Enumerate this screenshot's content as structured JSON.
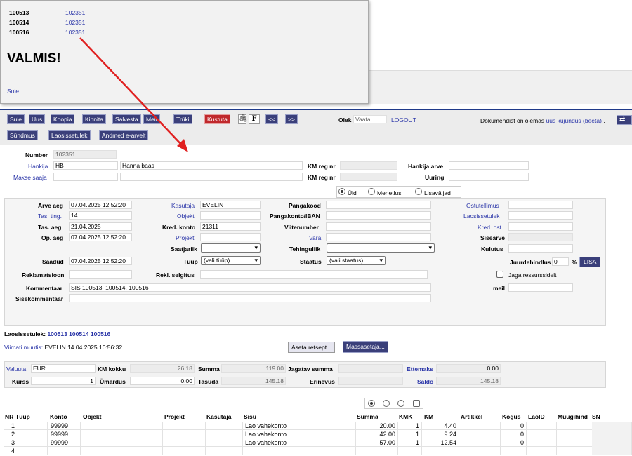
{
  "popup": {
    "rows": [
      {
        "id": "100513",
        "ref": "102351"
      },
      {
        "id": "100514",
        "ref": "102351"
      },
      {
        "id": "100516",
        "ref": "102351"
      }
    ],
    "done": "VALMIS!",
    "close": "Sule"
  },
  "toolbar": {
    "buttons": [
      "Sule",
      "Uus",
      "Koopia",
      "Kinnita",
      "Salvesta",
      "Meil",
      "Trüki",
      "Kustuta"
    ],
    "f_label": "F",
    "prev": "<<",
    "next": ">>",
    "olek_label": "Olek",
    "olek_value": "Vaata",
    "logout": "LOGOUT",
    "design_text": "Dokumendist on olemas",
    "design_link": "uus kujundus (beeta)",
    "design_dot": ".",
    "buttons2": [
      "Sündmus",
      "Laosissetulek",
      "Andmed e-arvelt"
    ]
  },
  "header": {
    "number_label": "Number",
    "number_value": "102351",
    "hankija_label": "Hankija",
    "hankija_code": "HB",
    "hankija_name": "Hanna baas",
    "km_reg_label": "KM reg nr",
    "hankija_arve_label": "Hankija arve",
    "makse_saaja_label": "Makse saaja",
    "km_reg_label2": "KM reg nr",
    "uuring_label": "Uuring"
  },
  "tabs": {
    "yld": "Üld",
    "menetlus": "Menetlus",
    "lisavaljad": "Lisaväljad"
  },
  "form": {
    "arve_aeg_label": "Arve aeg",
    "arve_aeg": "07.04.2025 12:52:20",
    "tas_ting_label": "Tas. ting.",
    "tas_ting": "14",
    "tas_aeg_label": "Tas. aeg",
    "tas_aeg": "21.04.2025",
    "op_aeg_label": "Op. aeg",
    "op_aeg": "07.04.2025 12:52:20",
    "saadud_label": "Saadud",
    "saadud": "07.04.2025 12:52:20",
    "reklamatsioon_label": "Reklamatsioon",
    "kommentaar_label": "Kommentaar",
    "kommentaar": "SIS 100513, 100514, 100516",
    "sisekommentaar_label": "Sisekommentaar",
    "kasutaja_label": "Kasutaja",
    "kasutaja": "EVELIN",
    "objekt_label": "Objekt",
    "kred_konto_label": "Kred. konto",
    "kred_konto": "21311",
    "projekt_label": "Projekt",
    "saatjariik_label": "Saatjariik",
    "tyyp_label": "Tüüp",
    "tyyp": "(vali tüüp)",
    "rekl_selgitus_label": "Rekl. selgitus",
    "pangakood_label": "Pangakood",
    "pangakonto_label": "Pangakonto/IBAN",
    "viitenumber_label": "Viitenumber",
    "vara_label": "Vara",
    "tehinguliik_label": "Tehinguliik",
    "staatus_label": "Staatus",
    "staatus": "(vali staatus)",
    "ostutellimus_label": "Ostutellimus",
    "laosissetulek_label": "Laosissetulek",
    "kred_ost_label": "Kred. ost",
    "sisearve_label": "Sisearve",
    "kulutus_label": "Kulutus",
    "juurdehindlus_label": "Juurdehindlus",
    "juurdehindlus": "0",
    "percent": "%",
    "lisa": "LISA",
    "jaga_label": "Jaga ressurssidelt",
    "meil_label": "meil"
  },
  "info": {
    "laosissetulek_label": "Laosissetulek:",
    "laosissetulek_links": "100513 100514 100516",
    "viimati_label": "Viimati muutis:",
    "viimati_value": "EVELIN 14.04.2025 10:56:32",
    "aseta_btn": "Aseta retsept...",
    "massasetaja_btn": "Massasetaja..."
  },
  "totals": {
    "valuuta_label": "Valuuta",
    "valuuta": "EUR",
    "km_kokku_label": "KM kokku",
    "km_kokku": "26.18",
    "summa_label": "Summa",
    "summa": "119.00",
    "jagatav_label": "Jagatav summa",
    "ettemaks_label": "Ettemaks",
    "ettemaks": "0.00",
    "kurss_label": "Kurss",
    "kurss": "1",
    "umardus_label": "Ümardus",
    "umardus": "0.00",
    "tasuda_label": "Tasuda",
    "tasuda": "145.18",
    "erinevus_label": "Erinevus",
    "saldo_label": "Saldo",
    "saldo": "145.18"
  },
  "grid": {
    "headers": [
      "NR",
      "Tüüp",
      "Konto",
      "Objekt",
      "Projekt",
      "Kasutaja",
      "Sisu",
      "Summa",
      "KMK",
      "KM",
      "Artikkel",
      "Kogus",
      "LaoID",
      "Müügihind",
      "SN"
    ],
    "rows": [
      {
        "nr": "1",
        "konto": "99999",
        "sisu": "Lao vahekonto",
        "summa": "20.00",
        "kmk": "1",
        "km": "4.40",
        "kogus": "0"
      },
      {
        "nr": "2",
        "konto": "99999",
        "sisu": "Lao vahekonto",
        "summa": "42.00",
        "kmk": "1",
        "km": "9.24",
        "kogus": "0"
      },
      {
        "nr": "3",
        "konto": "99999",
        "sisu": "Lao vahekonto",
        "summa": "57.00",
        "kmk": "1",
        "km": "12.54",
        "kogus": "0"
      },
      {
        "nr": "4",
        "konto": "",
        "sisu": "",
        "summa": "",
        "kmk": "",
        "km": "",
        "kogus": ""
      }
    ]
  },
  "colors": {
    "accent": "#3a3f7a",
    "link": "#2a35a8",
    "delete": "#c0282c",
    "arrow": "#e02020"
  }
}
